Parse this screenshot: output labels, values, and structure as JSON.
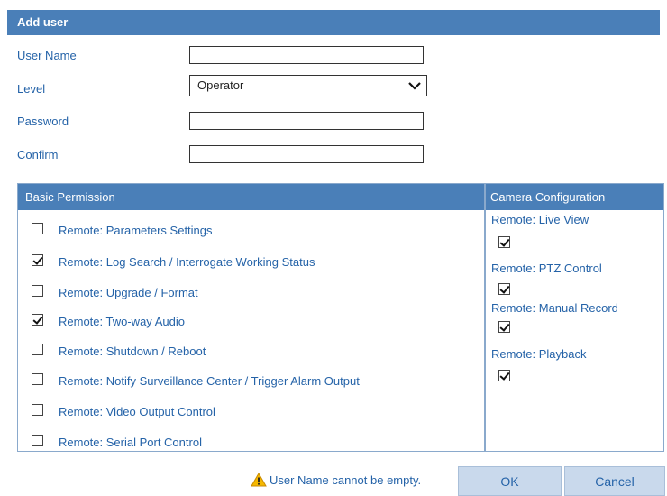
{
  "dialog": {
    "title": "Add user"
  },
  "form": {
    "user_name_label": "User Name",
    "user_name_value": "",
    "level_label": "Level",
    "level_value": "Operator",
    "password_label": "Password",
    "password_value": "",
    "confirm_label": "Confirm",
    "confirm_value": ""
  },
  "basic_permission": {
    "header": "Basic Permission",
    "items": [
      {
        "label": "Remote: Parameters Settings",
        "checked": false
      },
      {
        "label": "Remote: Log Search / Interrogate Working Status",
        "checked": true
      },
      {
        "label": "Remote: Upgrade / Format",
        "checked": false
      },
      {
        "label": "Remote: Two-way Audio",
        "checked": true
      },
      {
        "label": "Remote: Shutdown / Reboot",
        "checked": false
      },
      {
        "label": "Remote: Notify Surveillance Center / Trigger Alarm Output",
        "checked": false
      },
      {
        "label": "Remote: Video Output Control",
        "checked": false
      },
      {
        "label": "Remote: Serial Port Control",
        "checked": false
      }
    ]
  },
  "camera_configuration": {
    "header": "Camera Configuration",
    "items": [
      {
        "label": "Remote: Live View",
        "checked": true
      },
      {
        "label": "Remote: PTZ Control",
        "checked": true
      },
      {
        "label": "Remote: Manual Record",
        "checked": true
      },
      {
        "label": "Remote: Playback",
        "checked": true
      }
    ]
  },
  "footer": {
    "warning_text": "User Name cannot be empty.",
    "ok_label": "OK",
    "cancel_label": "Cancel"
  },
  "colors": {
    "header_bg": "#4a7fb8",
    "label_text": "#2563a8",
    "button_bg": "#c9d9ec"
  }
}
